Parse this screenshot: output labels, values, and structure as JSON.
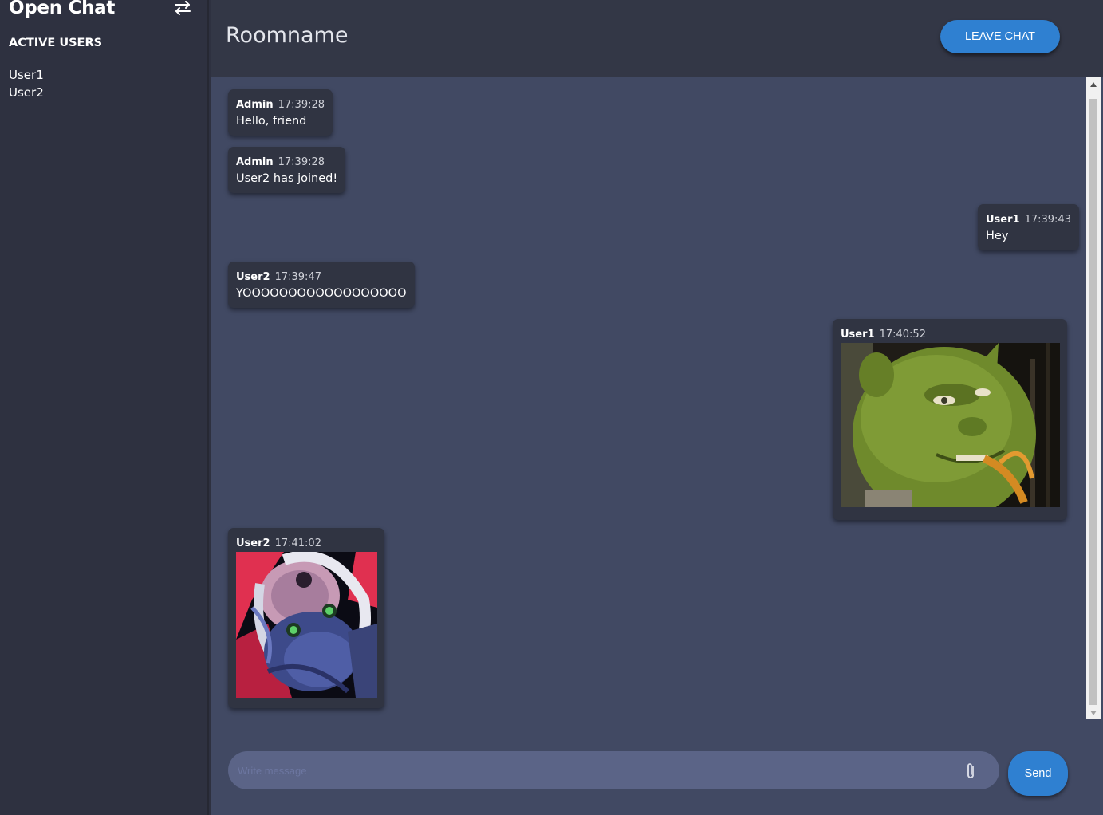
{
  "sidebar": {
    "app_title": "Open Chat",
    "switch_icon": "swap-arrows-icon",
    "users_heading": "ACTIVE USERS",
    "users": [
      "User1",
      "User2"
    ]
  },
  "header": {
    "room_title": "Roomname",
    "leave_label": "LEAVE CHAT"
  },
  "messages": [
    {
      "author": "Admin",
      "time": "17:39:28",
      "text": "Hello, friend",
      "side": "left"
    },
    {
      "author": "Admin",
      "time": "17:39:28",
      "text": "User2 has joined!",
      "side": "left"
    },
    {
      "author": "User1",
      "time": "17:39:43",
      "text": "Hey",
      "side": "right"
    },
    {
      "author": "User2",
      "time": "17:39:47",
      "text": "YOOOOOOOOOOOOOOOOOO",
      "side": "left"
    },
    {
      "author": "User1",
      "time": "17:40:52",
      "image": "shrek-meme-image",
      "side": "right"
    },
    {
      "author": "User2",
      "time": "17:41:02",
      "image": "anime-character-image",
      "side": "left"
    }
  ],
  "compose": {
    "placeholder": "Write message",
    "attach_icon": "paperclip-icon",
    "send_label": "Send"
  },
  "colors": {
    "sidebar_bg": "#2e3140",
    "header_bg": "#333746",
    "chat_bg": "#414963",
    "bubble_bg": "#303442",
    "accent": "#2f80d1",
    "input_bg": "#5b6487"
  }
}
